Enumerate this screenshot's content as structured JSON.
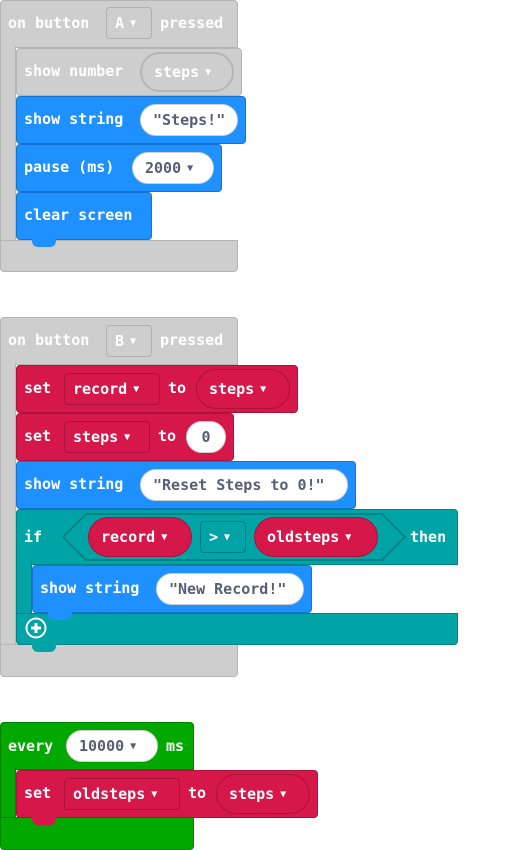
{
  "block_a": {
    "prefix": "on button",
    "button": "A",
    "suffix": "pressed",
    "show_number": {
      "label": "show number",
      "value": "steps"
    },
    "show_string": {
      "label": "show string",
      "value": "\"Steps!\""
    },
    "pause": {
      "label": "pause (ms)",
      "value": "2000"
    },
    "clear": {
      "label": "clear screen"
    }
  },
  "block_b": {
    "prefix": "on button",
    "button": "B",
    "suffix": "pressed",
    "set_record": {
      "label": "set",
      "var": "record",
      "to": "to",
      "value": "steps"
    },
    "set_steps": {
      "label": "set",
      "var": "steps",
      "to": "to",
      "value": "0"
    },
    "show_string": {
      "label": "show string",
      "value": "\"Reset Steps to 0!\""
    },
    "if_block": {
      "if_label": "if",
      "left": "record",
      "op": ">",
      "right": "oldsteps",
      "then_label": "then",
      "inner_show": {
        "label": "show string",
        "value": "\"New Record!\""
      },
      "add_icon": "plus-circle"
    }
  },
  "block_every": {
    "prefix": "every",
    "interval": "10000",
    "unit": "ms",
    "set_old": {
      "label": "set",
      "var": "oldsteps",
      "to": "to",
      "value": "steps"
    }
  },
  "colors": {
    "events_gray": "#cecece",
    "basic_blue": "#1e90ff",
    "variables_red": "#d6174a",
    "logic_teal": "#00a4a6",
    "loops_green": "#00a800"
  },
  "icons": {
    "caret": "caret-down-icon"
  }
}
